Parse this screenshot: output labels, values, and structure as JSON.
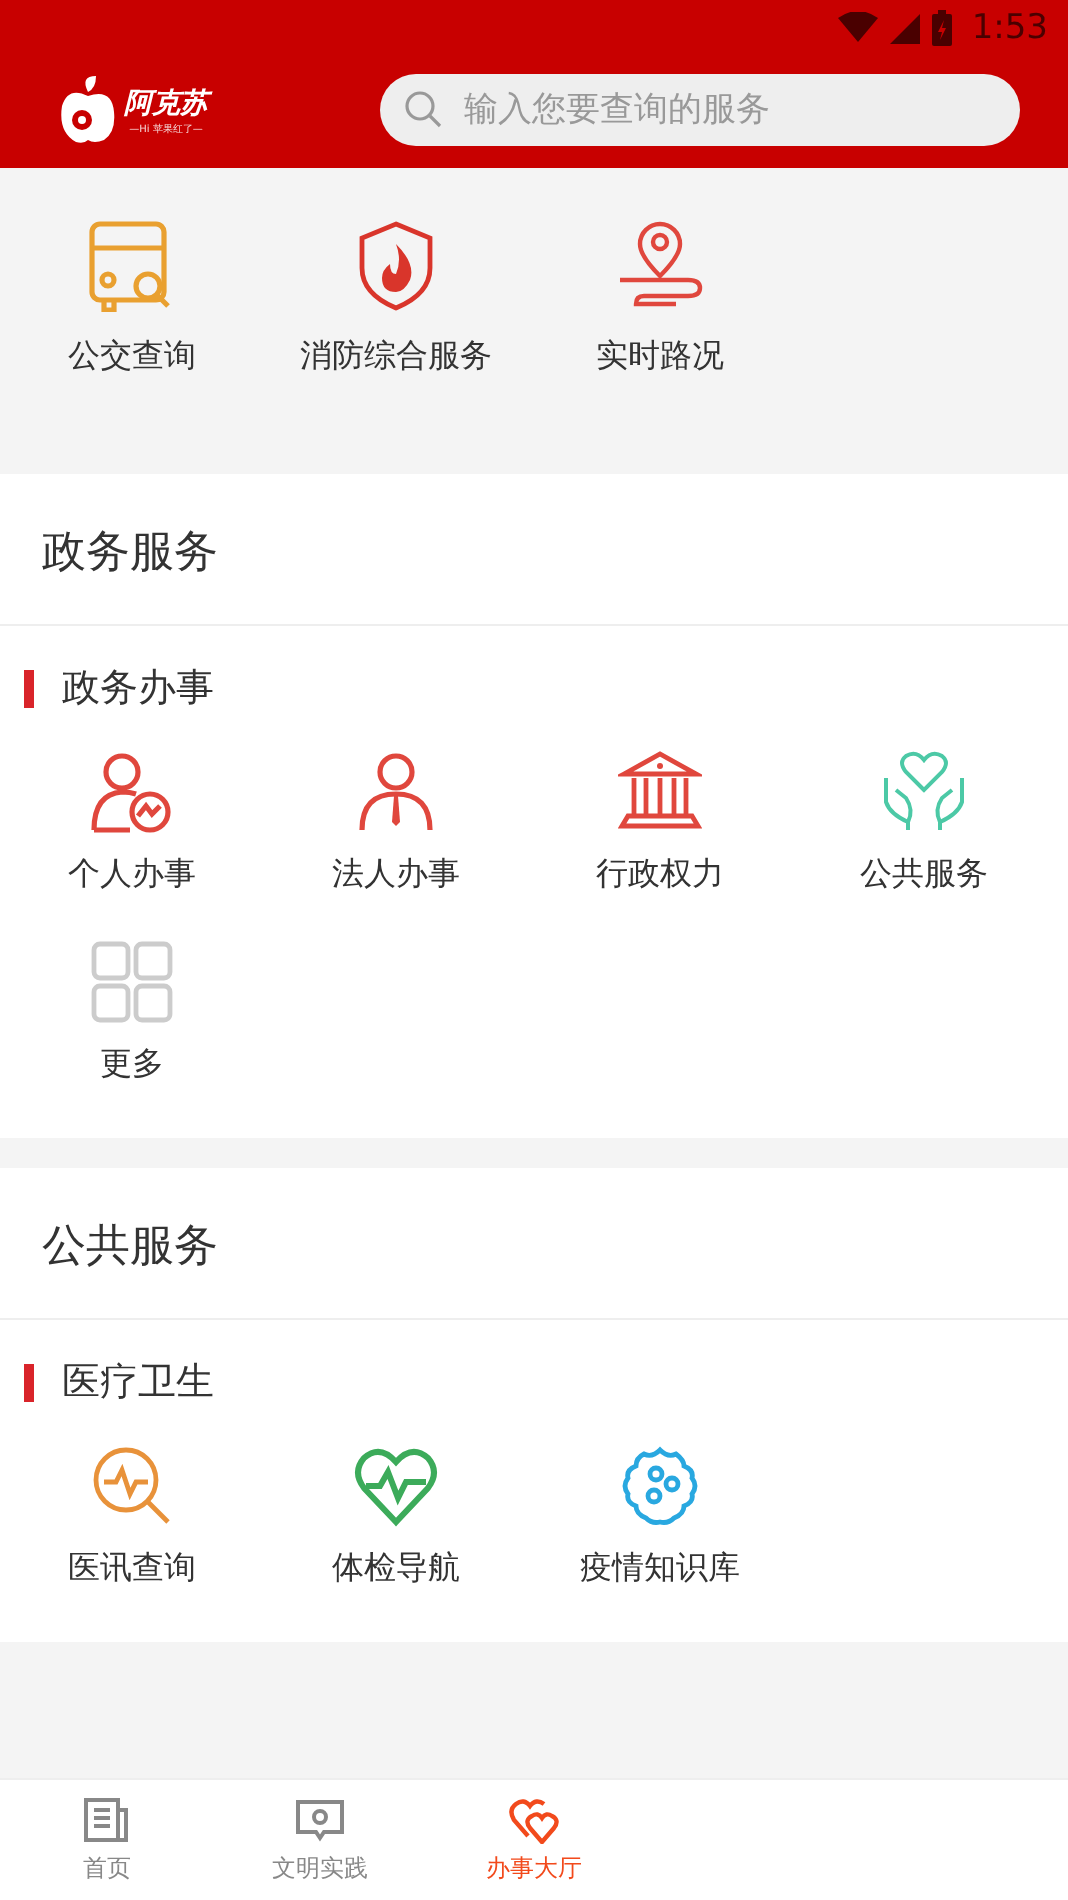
{
  "status_bar": {
    "time": "1:53"
  },
  "app_bar": {
    "logo_name": "阿克苏",
    "logo_slogan": "—Hi 苹果红了—",
    "search": {
      "placeholder": "输入您要查询的服务"
    }
  },
  "quick_links": [
    {
      "label": "公交查询",
      "kind": "bus"
    },
    {
      "label": "消防综合服务",
      "kind": "fire"
    },
    {
      "label": "实时路况",
      "kind": "route"
    }
  ],
  "sections": [
    {
      "title": "政务服务",
      "groups": [
        {
          "title": "政务办事",
          "items": [
            {
              "label": "个人办事",
              "kind": "person"
            },
            {
              "label": "法人办事",
              "kind": "tie"
            },
            {
              "label": "行政权力",
              "kind": "building"
            },
            {
              "label": "公共服务",
              "kind": "hands"
            },
            {
              "label": "更多",
              "kind": "grid"
            }
          ]
        }
      ]
    },
    {
      "title": "公共服务",
      "groups": [
        {
          "title": "医疗卫生",
          "items": [
            {
              "label": "医讯查询",
              "kind": "pulse"
            },
            {
              "label": "体检导航",
              "kind": "heart"
            },
            {
              "label": "疫情知识库",
              "kind": "virus"
            }
          ]
        }
      ]
    }
  ],
  "bottom_nav": [
    {
      "label": "首页",
      "kind": "news",
      "selected": false
    },
    {
      "label": "文明实践",
      "kind": "chat",
      "selected": false
    },
    {
      "label": "办事大厅",
      "kind": "hearts",
      "selected": true
    }
  ]
}
